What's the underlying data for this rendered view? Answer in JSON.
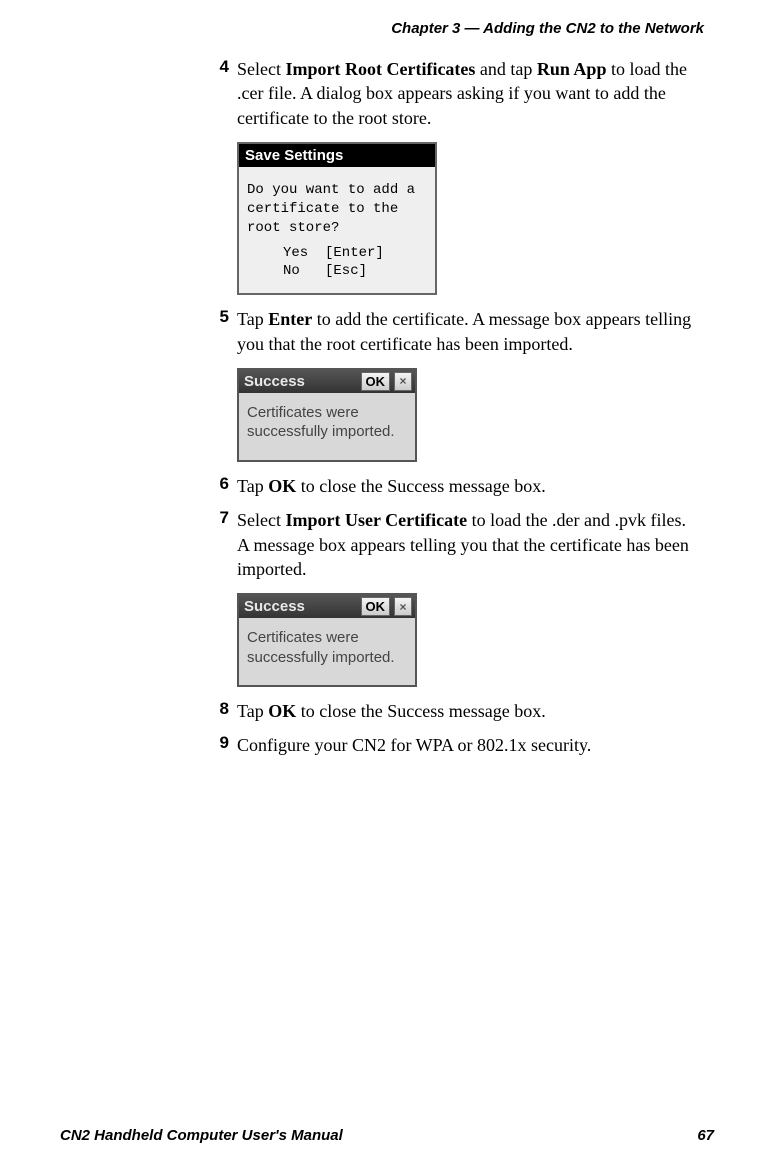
{
  "header": {
    "chapter_title": "Chapter 3 — Adding the CN2 to the Network"
  },
  "steps": {
    "s4": {
      "num": "4",
      "t1": "Select ",
      "b1": "Import Root Certificates",
      "t2": " and tap ",
      "b2": "Run App",
      "t3": " to load the .cer file. A dialog box appears asking if you want to add the certificate to the root store."
    },
    "s5": {
      "num": "5",
      "t1": "Tap ",
      "b1": "Enter",
      "t2": " to add the certificate. A message box appears telling you that the root certificate has been imported."
    },
    "s6": {
      "num": "6",
      "t1": "Tap ",
      "b1": "OK",
      "t2": " to close the Success message box."
    },
    "s7": {
      "num": "7",
      "t1": "Select ",
      "b1": "Import User Certificate",
      "t2": " to load the .der and .pvk files. A message box appears telling you that the certificate has been imported."
    },
    "s8": {
      "num": "8",
      "t1": "Tap ",
      "b1": "OK",
      "t2": " to close the Success message box."
    },
    "s9": {
      "num": "9",
      "t1": "Configure your CN2 for WPA or 802.1x security."
    }
  },
  "screenshots": {
    "save_settings": {
      "title": "Save Settings",
      "question": "Do you want to add a certificate to the root store?",
      "options": "Yes  [Enter]\nNo   [Esc]"
    },
    "success1": {
      "title": "Success",
      "ok": "OK",
      "close": "×",
      "body": "Certificates were successfully imported."
    },
    "success2": {
      "title": "Success",
      "ok": "OK",
      "close": "×",
      "body": "Certificates were successfully imported."
    }
  },
  "footer": {
    "manual_title": "CN2 Handheld Computer User's Manual",
    "page_number": "67"
  }
}
